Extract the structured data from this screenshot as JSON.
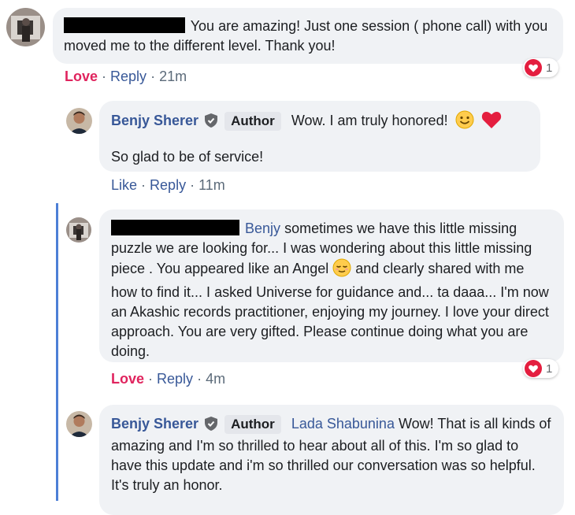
{
  "comments": [
    {
      "text": "You are amazing! Just one session ( phone call) with you moved me to the different level. Thank you!",
      "actions": {
        "react": "Love",
        "reply": "Reply",
        "time": "21m"
      },
      "reaction_count": "1"
    },
    {
      "author": "Benjy Sherer",
      "author_badge": "Author",
      "text_line1": "Wow. I am truly honored!",
      "text_line2": "So glad to be of service!",
      "actions": {
        "react": "Like",
        "reply": "Reply",
        "time": "11m"
      }
    },
    {
      "mention": "Benjy",
      "text": "sometimes we have this little missing puzzle we are looking for... I was wondering about this little missing piece . You appeared like an Angel",
      "text_after": "and clearly shared with me how to find it... I asked Universe for guidance and... ta daaa... I'm now an Akashic records practitioner, enjoying my journey. I love your direct approach. You are very gifted. Please continue doing what you are doing.",
      "actions": {
        "react": "Love",
        "reply": "Reply",
        "time": "4m"
      },
      "reaction_count": "1"
    },
    {
      "author": "Benjy Sherer",
      "author_badge": "Author",
      "mention": "Lada Shabunina",
      "text": "Wow! That is all kinds of amazing and I'm so thrilled to hear about all of this. I'm so glad to have this update and i'm so thrilled our conversation was so helpful. It's truly an honor."
    }
  ],
  "colors": {
    "link": "#385898",
    "love": "#e0245e",
    "bubble": "#f0f2f5",
    "thread": "#4d7fd6",
    "heart": "#e41e3f"
  },
  "icons": {
    "author_badge": "shield-check-icon",
    "reaction": "heart-icon",
    "emoji_smile": "smiling-face-icon",
    "emoji_heart": "red-heart-icon",
    "emoji_angel": "relieved-face-icon"
  }
}
